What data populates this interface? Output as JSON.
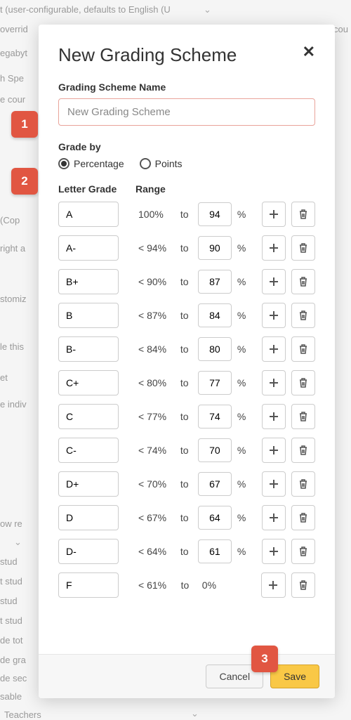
{
  "modal": {
    "title": "New Grading Scheme",
    "name_label": "Grading Scheme Name",
    "name_placeholder": "New Grading Scheme",
    "grade_by_label": "Grade by",
    "options": {
      "percentage": "Percentage",
      "points": "Points",
      "selected": "percentage"
    },
    "headers": {
      "letter": "Letter Grade",
      "range": "Range"
    },
    "to_text": "to",
    "pct": "%",
    "grades": [
      {
        "letter": "A",
        "upper": "100%",
        "lower": "94"
      },
      {
        "letter": "A-",
        "upper": "< 94%",
        "lower": "90"
      },
      {
        "letter": "B+",
        "upper": "< 90%",
        "lower": "87"
      },
      {
        "letter": "B",
        "upper": "< 87%",
        "lower": "84"
      },
      {
        "letter": "B-",
        "upper": "< 84%",
        "lower": "80"
      },
      {
        "letter": "C+",
        "upper": "< 80%",
        "lower": "77"
      },
      {
        "letter": "C",
        "upper": "< 77%",
        "lower": "74"
      },
      {
        "letter": "C-",
        "upper": "< 74%",
        "lower": "70"
      },
      {
        "letter": "D+",
        "upper": "< 70%",
        "lower": "67"
      },
      {
        "letter": "D",
        "upper": "< 67%",
        "lower": "64"
      },
      {
        "letter": "D-",
        "upper": "< 64%",
        "lower": "61"
      },
      {
        "letter": "F",
        "upper": "< 61%",
        "lower_text": "0%"
      }
    ],
    "footer": {
      "cancel": "Cancel",
      "save": "Save"
    }
  },
  "callouts": {
    "one": "1",
    "two": "2",
    "three": "3"
  },
  "bg": {
    "a": "t (user-configurable, defaults to English (U",
    "b": "overrid",
    "c": "egabyt",
    "d": "h Spe",
    "e": "e cour",
    "f": "(Cop",
    "g": "right a",
    "h": "stomiz",
    "i": "le this",
    "j": "et",
    "k": "e indiv",
    "l": "ow re",
    "m": "stud",
    "n": "t stud",
    "o": "stud",
    "p": "t stud",
    "q": "de tot",
    "r": "de gra",
    "s": "de sec",
    "t": "sable",
    "u": "Teachers",
    "v": "cou"
  }
}
